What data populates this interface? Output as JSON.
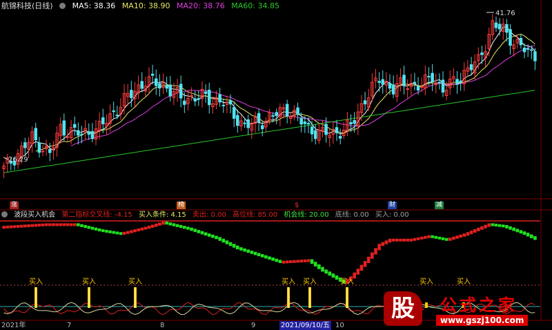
{
  "header": {
    "title": "航锦科技(日线)",
    "ma5": "MA5: 38.36",
    "ma10": "MA10: 38.90",
    "ma20": "MA20: 38.76",
    "ma60": "MA60: 34.85"
  },
  "colors": {
    "up": "#ff3c3c",
    "down": "#50e4f0",
    "ma5": "#ffffff",
    "ma10": "#e8e864",
    "ma20": "#e040e0",
    "ma60": "#28c828",
    "buy": "#ffc800"
  },
  "price": {
    "high_label": "41.76",
    "low_label": "26.29",
    "ylim": [
      24,
      43
    ]
  },
  "markers": {
    "zhang": "涨",
    "hong": "椅",
    "cai": "财",
    "jian": "减",
    "dollar": "$"
  },
  "indicator": {
    "title": "波段买入机会",
    "line1": "第二指标交叉线: -4.15",
    "line2": "买入条件: 4.15",
    "line3": "卖出: 0.00",
    "line4": "高位线: 85.00",
    "line5": "机会线: 20.00",
    "line6": "底线: 0.00",
    "line7": "买入: 0.00",
    "buy_label": "买入"
  },
  "xaxis": {
    "year": "2021年",
    "m7": "7",
    "m8": "8",
    "m9": "9",
    "selected": "2021/09/10/五",
    "m10": "10"
  },
  "watermark": {
    "logo": "股",
    "name": "公式之家",
    "url": "www.gszj100.com"
  },
  "chart_data": {
    "type": "candlestick",
    "title": "航锦科技(日线)",
    "moving_averages": {
      "MA5": 38.36,
      "MA10": 38.9,
      "MA20": 38.76,
      "MA60": 34.85
    },
    "visible_high": 41.76,
    "visible_low": 26.29,
    "close_keypoints": [
      [
        0,
        26.9
      ],
      [
        8,
        30.0
      ],
      [
        13,
        28.4
      ],
      [
        16,
        31.0
      ],
      [
        22,
        30.4
      ],
      [
        27,
        31.0
      ],
      [
        34,
        33.8
      ],
      [
        40,
        35.8
      ],
      [
        45,
        35.4
      ],
      [
        50,
        34.0
      ],
      [
        56,
        34.2
      ],
      [
        62,
        33.6
      ],
      [
        68,
        31.2
      ],
      [
        74,
        31.9
      ],
      [
        80,
        33.0
      ],
      [
        86,
        31.0
      ],
      [
        90,
        30.4
      ],
      [
        94,
        30.6
      ],
      [
        98,
        31.2
      ],
      [
        102,
        34.0
      ],
      [
        106,
        36.0
      ],
      [
        110,
        35.0
      ],
      [
        114,
        35.6
      ],
      [
        118,
        35.2
      ],
      [
        121,
        36.4
      ],
      [
        124,
        34.8
      ],
      [
        128,
        36.0
      ],
      [
        134,
        37.8
      ],
      [
        138,
        41.4
      ],
      [
        141,
        41.0
      ],
      [
        145,
        39.4
      ],
      [
        150,
        38.4
      ]
    ],
    "indicator_buy_signals": 8
  }
}
